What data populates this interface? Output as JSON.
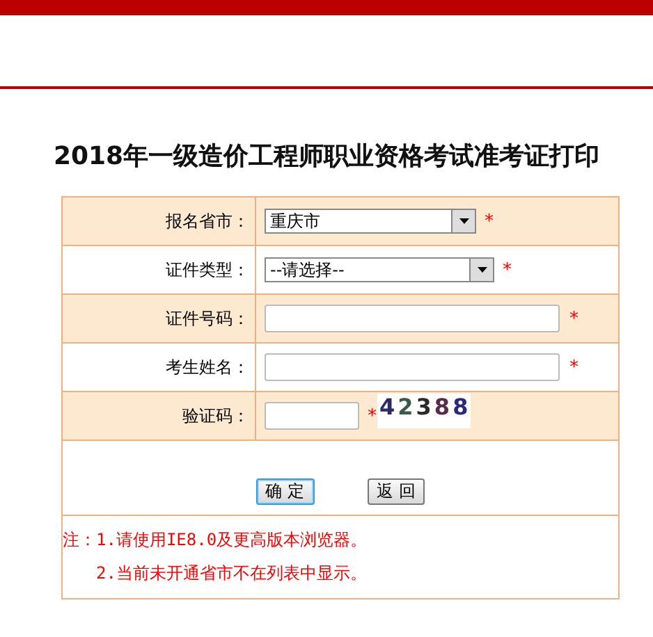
{
  "title": "2018年一级造价工程师职业资格考试准考证打印",
  "form_rows": [
    {
      "kind": "select",
      "label": "报名省市：",
      "value": "重庆市",
      "required": "*",
      "shaded": true
    },
    {
      "kind": "select",
      "label": "证件类型：",
      "value": "--请选择--",
      "required": "*",
      "shaded": false
    },
    {
      "kind": "input",
      "label": "证件号码：",
      "required": "*",
      "shaded": true
    },
    {
      "kind": "input",
      "label": "考生姓名：",
      "required": "*",
      "shaded": false
    },
    {
      "kind": "captcha",
      "label": "验证码：",
      "required": "*",
      "captcha": "42388",
      "shaded": true
    }
  ],
  "buttons": [
    {
      "label": "确 定",
      "focused": true
    },
    {
      "label": "返 回",
      "focused": false
    }
  ],
  "notes": [
    "注：1.请使用IE8.0及更高版本浏览器。",
    "2.当前未开通省市不在列表中显示。"
  ]
}
